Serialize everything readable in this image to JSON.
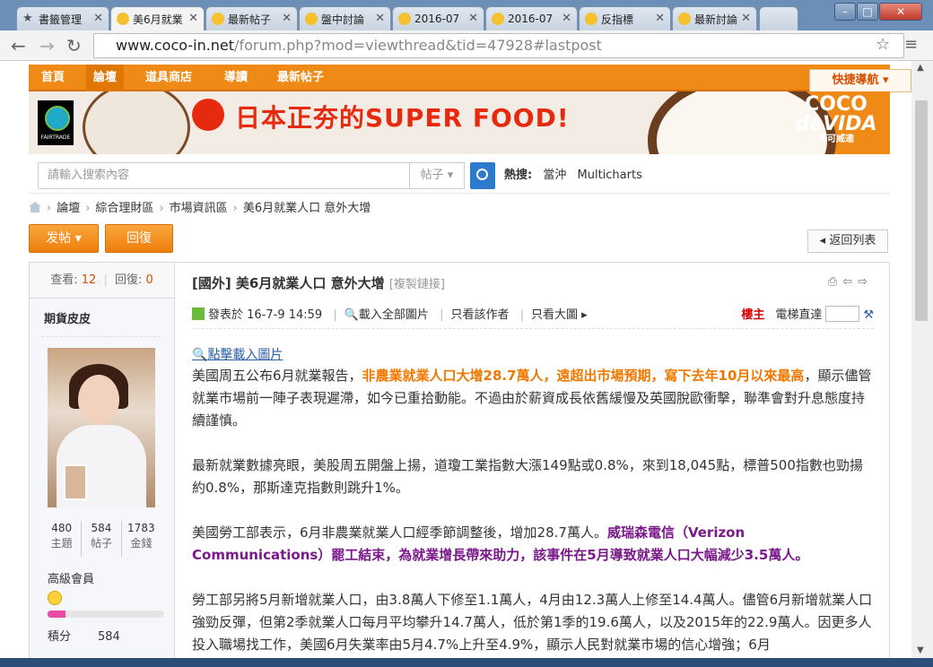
{
  "browser": {
    "tabs": [
      {
        "label": "書籤管理",
        "icon": "star-icon"
      },
      {
        "label": "美6月就業",
        "icon": "coco-favicon"
      },
      {
        "label": "最新帖子",
        "icon": "coco-favicon"
      },
      {
        "label": "盤中討論",
        "icon": "coco-favicon"
      },
      {
        "label": "2016-07",
        "icon": "coco-favicon"
      },
      {
        "label": "2016-07",
        "icon": "coco-favicon"
      },
      {
        "label": "反指標",
        "icon": "coco-favicon"
      },
      {
        "label": "最新討論",
        "icon": "smiley-favicon"
      }
    ],
    "url_host": "www.coco-in.net",
    "url_path": "/forum.php?mod=viewthread&tid=47928#lastpost"
  },
  "nav": {
    "items": [
      "首頁",
      "論壇",
      "道具商店",
      "導讀",
      "最新帖子"
    ],
    "current": "論壇",
    "quick_nav": "快捷導航"
  },
  "banner": {
    "fairtrade": "FAIRTRADE",
    "headline": "日本正夯的SUPER FOOD!",
    "brand_line1": "COCO",
    "brand_line2": "deVIDA",
    "brand_line3": "可可威達"
  },
  "search": {
    "placeholder": "請輸入搜索內容",
    "type": "帖子",
    "hot_label": "熱搜:",
    "hot_terms": [
      "當沖",
      "Multicharts"
    ]
  },
  "breadcrumb": [
    "論壇",
    "綜合理財區",
    "市場資訊區",
    "美6月就業人口 意外大增"
  ],
  "actions": {
    "post": "发帖",
    "reply": "回復",
    "back": "返回列表"
  },
  "thread": {
    "views_label": "查看:",
    "views": "12",
    "replies_label": "回復:",
    "replies": "0",
    "title": "[國外] 美6月就業人口 意外大增",
    "copy_link": "[複製鏈接]"
  },
  "author": {
    "name": "期貨皮皮",
    "stats": [
      {
        "value": "480",
        "label": "主題"
      },
      {
        "value": "584",
        "label": "帖子"
      },
      {
        "value": "1783",
        "label": "金錢"
      }
    ],
    "level": "高級會員",
    "level_progress": 0.15,
    "points_label": "積分",
    "points": "584"
  },
  "meta": {
    "posted": "發表於 16-7-9 14:59",
    "load_all": "載入全部圖片",
    "only_author": "只看該作者",
    "big_images": "只看大圖",
    "owner": "樓主",
    "jump": "電梯直達"
  },
  "content": {
    "load_images": "點擊載入圖片",
    "p1_a": "美國周五公布6月就業報告，",
    "p1_hl": "非農業就業人口大增28.7萬人，遠超出市場預期，寫下去年10月以來最高",
    "p1_b": "，顯示儘管就業市場前一陣子表現遲滯，如今已重拾動能。不過由於薪資成長依舊緩慢及英國脫歐衝擊，聯準會對升息態度持續謹慎。",
    "p2": "最新就業數據亮眼，美股周五開盤上揚，道瓊工業指數大漲149點或0.8%，來到18,045點，標普500指數也勁揚約0.8%，那斯達克指數則跳升1%。",
    "p3_a": "美國勞工部表示，6月非農業就業人口經季節調整後，增加28.7萬人。",
    "p3_hl": "威瑞森電信（Verizon Communications）罷工結束，為就業增長帶來助力，該事件在5月導致就業人口大幅減少3.5萬人。",
    "p4": "勞工部另將5月新增就業人口，由3.8萬人下修至1.1萬人，4月由12.3萬人上修至14.4萬人。儘管6月新增就業人口強勁反彈，但第2季就業人口每月平均攀升14.7萬人，低於第1季的19.6萬人，以及2015年的22.9萬人。因更多人投入職場找工作，美國6月失業率由5月4.7%上升至4.9%，顯示人民對就業市場的信心增強；6月"
  }
}
